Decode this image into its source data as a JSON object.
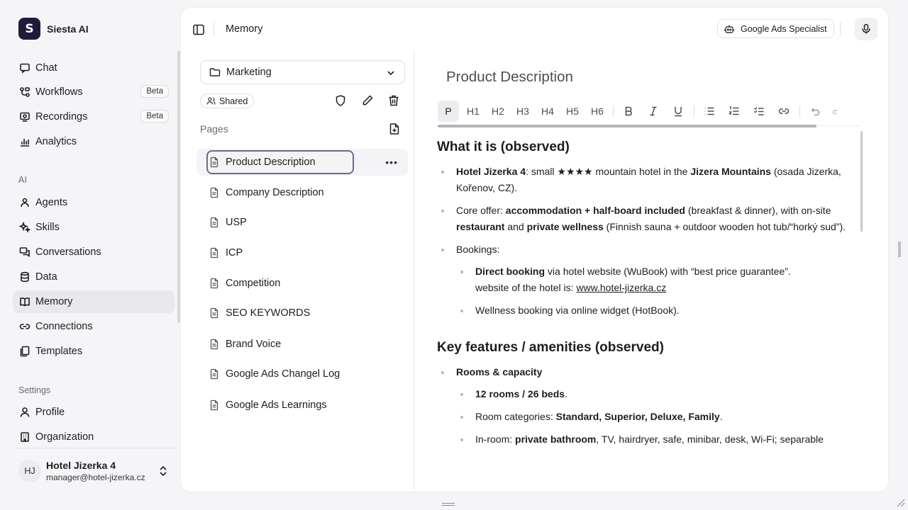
{
  "brand": {
    "name": "Siesta AI",
    "logo_letter": "S"
  },
  "sidebar": {
    "items": [
      {
        "label": "Chat",
        "icon": "chat-icon"
      },
      {
        "label": "Workflows",
        "icon": "workflow-icon",
        "badge": "Beta"
      },
      {
        "label": "Recordings",
        "icon": "recording-icon",
        "badge": "Beta"
      },
      {
        "label": "Analytics",
        "icon": "analytics-icon"
      }
    ],
    "ai_section": "AI",
    "ai_items": [
      {
        "label": "Agents",
        "icon": "agent-icon"
      },
      {
        "label": "Skills",
        "icon": "sparkles-icon"
      },
      {
        "label": "Conversations",
        "icon": "conversations-icon"
      },
      {
        "label": "Data",
        "icon": "database-icon"
      },
      {
        "label": "Memory",
        "icon": "book-icon",
        "active": true
      },
      {
        "label": "Connections",
        "icon": "link-icon"
      },
      {
        "label": "Templates",
        "icon": "templates-icon"
      }
    ],
    "settings_section": "Settings",
    "settings_items": [
      {
        "label": "Profile",
        "icon": "user-icon"
      },
      {
        "label": "Organization",
        "icon": "building-icon"
      }
    ]
  },
  "user": {
    "initials": "HJ",
    "name": "Hotel Jizerka 4",
    "email": "manager@hotel-jizerka.cz"
  },
  "topbar": {
    "title": "Memory",
    "agent": "Google Ads Specialist"
  },
  "pages_panel": {
    "folder": "Marketing",
    "shared_label": "Shared",
    "pages_label": "Pages",
    "pages": [
      "Product Description",
      "Company Description",
      "USP",
      "ICP",
      "Competition",
      "SEO KEYWORDS",
      "Brand Voice",
      "Google Ads Changel Log",
      "Google Ads Learnings"
    ],
    "more_label": "•••"
  },
  "editor": {
    "title": "Product Description",
    "toolbar": [
      "P",
      "H1",
      "H2",
      "H3",
      "H4",
      "H5",
      "H6"
    ],
    "section1": {
      "heading": "What it is (observed)",
      "b1": {
        "bold1": "Hotel Jizerka 4",
        "t1": ": small ★★★★ mountain hotel in the ",
        "bold2": "Jizera Mountains",
        "t2": " (osada Jizerka, Kořenov, CZ)."
      },
      "b2": {
        "t1": "Core offer: ",
        "bold1": "accommodation + half-board included",
        "t2": " (breakfast & dinner), with on-site ",
        "bold2": "restaurant",
        "t3": " and ",
        "bold3": "private wellness",
        "t4": " (Finnish sauna + outdoor wooden hot tub/“horký sud”)."
      },
      "b3": "Bookings:",
      "b3_1": {
        "bold1": "Direct booking",
        "t1": " via hotel website (WuBook) with “best price guarantee”.",
        "t2": "website of the hotel is: ",
        "link": "www.hotel-jizerka.cz"
      },
      "b3_2": "Wellness booking via online widget (HotBook)."
    },
    "section2": {
      "heading": "Key features / amenities (observed)",
      "b1": "Rooms & capacity",
      "b1_1": "12 rooms / 26 beds",
      "b1_1_tail": ".",
      "b1_2": {
        "t1": "Room categories: ",
        "bold1": "Standard, Superior, Deluxe, Family",
        "t2": "."
      },
      "b1_3": {
        "t1": "In-room: ",
        "bold1": "private bathroom",
        "t2": ", TV, hairdryer, safe, minibar, desk, Wi-Fi; separable"
      }
    }
  },
  "colors": {
    "accent": "#1f1b3a",
    "active_bg": "#eae8ee",
    "focus_ring": "#6e6a8e"
  }
}
